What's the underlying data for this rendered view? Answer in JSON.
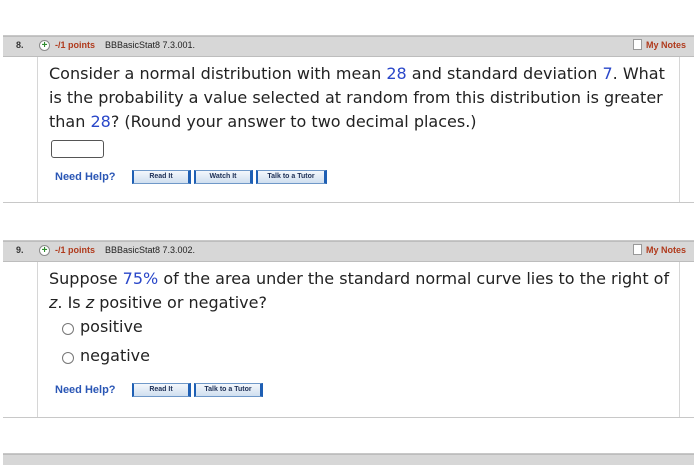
{
  "questions": [
    {
      "number": "8.",
      "points": "-/1 points",
      "source": "BBBasicStat8 7.3.001.",
      "notes_label": "My Notes",
      "text": {
        "p1": "Consider a normal distribution with mean ",
        "mean": "28",
        "p2": " and standard deviation ",
        "sd": "7",
        "p3": ". What is the probability a value selected at random from this distribution is greater than ",
        "value": "28",
        "p4": "? (Round your answer to two decimal places.)"
      },
      "answer_value": "",
      "help_label": "Need Help?",
      "buttons": [
        "Read It",
        "Watch It",
        "Talk to a Tutor"
      ]
    },
    {
      "number": "9.",
      "points": "-/1 points",
      "source": "BBBasicStat8 7.3.002.",
      "notes_label": "My Notes",
      "text": {
        "p1": "Suppose ",
        "percent": "75%",
        "p2": " of the area under the standard normal curve lies to the right of ",
        "z1": "z",
        "p3": ". Is ",
        "z2": "z",
        "p4": " positive or negative?"
      },
      "options": [
        "positive",
        "negative"
      ],
      "help_label": "Need Help?",
      "buttons": [
        "Read It",
        "Talk to a Tutor"
      ]
    }
  ],
  "colors": {
    "points": "#b03a1c",
    "value_highlight": "#2a47c9",
    "help": "#2a56b5",
    "header_bg": "#d7d7d7"
  }
}
